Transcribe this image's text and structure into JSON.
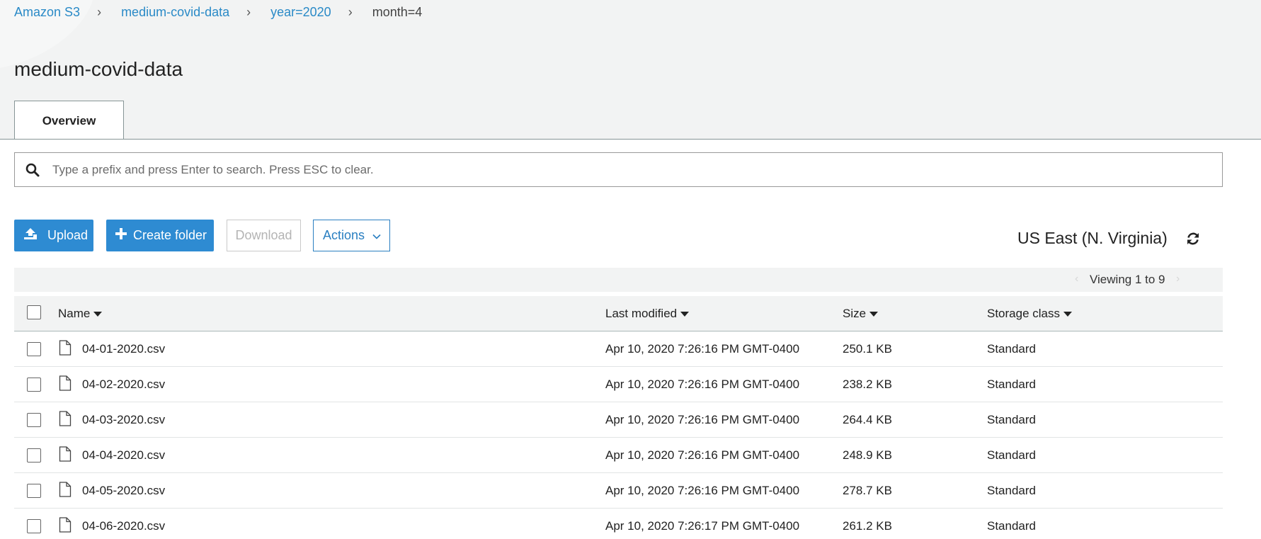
{
  "breadcrumb": {
    "items": [
      {
        "label": "Amazon S3"
      },
      {
        "label": "medium-covid-data"
      },
      {
        "label": "year=2020"
      }
    ],
    "current": "month=4",
    "separator": "›"
  },
  "page": {
    "title": "medium-covid-data",
    "tabs": [
      {
        "label": "Overview",
        "active": true
      }
    ]
  },
  "search": {
    "placeholder": "Type a prefix and press Enter to search. Press ESC to clear.",
    "value": "",
    "icon": "search-icon"
  },
  "toolbar": {
    "upload_label": "Upload",
    "create_folder_label": "Create folder",
    "download_label": "Download",
    "actions_label": "Actions",
    "region": "US East (N. Virginia)",
    "refresh_icon": "refresh-icon"
  },
  "pagination": {
    "text": "Viewing 1 to 9",
    "prev": "‹",
    "next": "›"
  },
  "table": {
    "columns": [
      "Name",
      "Last modified",
      "Size",
      "Storage class"
    ],
    "rows": [
      {
        "name": "04-01-2020.csv",
        "modified": "Apr 10, 2020 7:26:16 PM GMT-0400",
        "size": "250.1 KB",
        "storage": "Standard"
      },
      {
        "name": "04-02-2020.csv",
        "modified": "Apr 10, 2020 7:26:16 PM GMT-0400",
        "size": "238.2 KB",
        "storage": "Standard"
      },
      {
        "name": "04-03-2020.csv",
        "modified": "Apr 10, 2020 7:26:16 PM GMT-0400",
        "size": "264.4 KB",
        "storage": "Standard"
      },
      {
        "name": "04-04-2020.csv",
        "modified": "Apr 10, 2020 7:26:16 PM GMT-0400",
        "size": "248.9 KB",
        "storage": "Standard"
      },
      {
        "name": "04-05-2020.csv",
        "modified": "Apr 10, 2020 7:26:16 PM GMT-0400",
        "size": "278.7 KB",
        "storage": "Standard"
      },
      {
        "name": "04-06-2020.csv",
        "modified": "Apr 10, 2020 7:26:17 PM GMT-0400",
        "size": "261.2 KB",
        "storage": "Standard"
      }
    ]
  },
  "colors": {
    "primary": "#2e8bd2",
    "link": "#2a8ac7",
    "header_bg": "#f2f3f3"
  }
}
